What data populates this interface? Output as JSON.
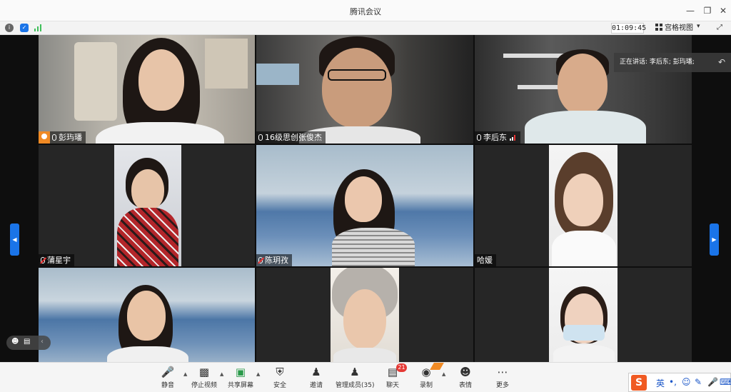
{
  "window": {
    "title": "腾讯会议"
  },
  "infobar": {
    "timer": "01:09:45",
    "view_mode": "宫格视图"
  },
  "speaking": {
    "text": "正在讲话: 李后东; 彭玙璠;"
  },
  "participants": [
    {
      "name": "彭玙璠",
      "host": true
    },
    {
      "name": "16级思创张俊杰"
    },
    {
      "name": "李后东",
      "active": true
    },
    {
      "name": "蒲星宇"
    },
    {
      "name": "陈玥孜"
    },
    {
      "name": "哈媛"
    },
    {
      "name": ""
    },
    {
      "name": ""
    },
    {
      "name": ""
    }
  ],
  "toolbar": {
    "mute": "静音",
    "stop_video": "停止视频",
    "share": "共享屏幕",
    "security": "安全",
    "invite": "邀请",
    "members": "管理成员(35)",
    "chat": "聊天",
    "chat_badge": "21",
    "record": "录制",
    "reactions": "表情",
    "more": "更多"
  },
  "ime": {
    "logo": "S",
    "lang": "英"
  },
  "colors": {
    "accent": "#1a74e8",
    "active_border": "#3fbf5a",
    "host_badge": "#f08a24",
    "badge": "#e53935"
  }
}
